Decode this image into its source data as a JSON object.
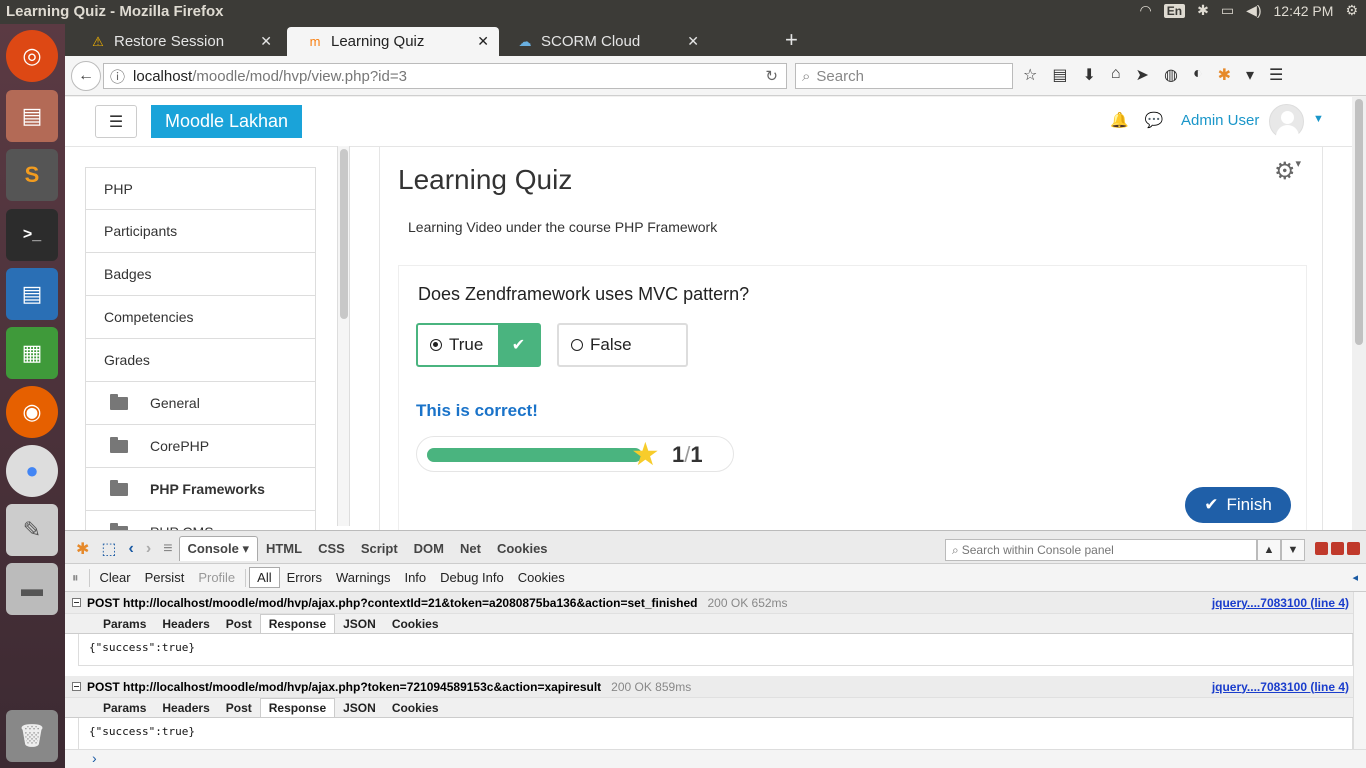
{
  "window": {
    "title": "Learning Quiz - Mozilla Firefox"
  },
  "system_tray": {
    "lang": "En",
    "time": "12:42 PM"
  },
  "tabs": [
    {
      "label": "Restore Session",
      "icon": "warning-icon",
      "active": false
    },
    {
      "label": "Learning Quiz",
      "icon": "moodle-icon",
      "active": true
    },
    {
      "label": "SCORM Cloud",
      "icon": "cloud-icon",
      "active": false
    }
  ],
  "navbar": {
    "url_host": "localhost",
    "url_path": "/moodle/mod/hvp/view.php?id=3",
    "search_placeholder": "Search"
  },
  "site": {
    "brand": "Moodle Lakhan",
    "menu_icon": "☰",
    "user": "Admin User"
  },
  "drawer": {
    "items": [
      {
        "label": "PHP",
        "sub": false,
        "bold": false
      },
      {
        "label": "Participants",
        "sub": false,
        "bold": false
      },
      {
        "label": "Badges",
        "sub": false,
        "bold": false
      },
      {
        "label": "Competencies",
        "sub": false,
        "bold": false
      },
      {
        "label": "Grades",
        "sub": false,
        "bold": false
      },
      {
        "label": "General",
        "sub": true,
        "bold": false
      },
      {
        "label": "CorePHP",
        "sub": true,
        "bold": false
      },
      {
        "label": "PHP Frameworks",
        "sub": true,
        "bold": true
      },
      {
        "label": "PHP CMS",
        "sub": true,
        "bold": false
      }
    ]
  },
  "main": {
    "title": "Learning Quiz",
    "description": "Learning Video under the course PHP Framework",
    "question": "Does Zendframework uses MVC pattern?",
    "answers": {
      "true_label": "True",
      "false_label": "False"
    },
    "feedback": "This is correct!",
    "score": {
      "earned": "1",
      "separator": "/",
      "max": "1",
      "fill_fraction": 1.0
    },
    "finish_label": "Finish"
  },
  "firebug": {
    "tabs": [
      "Console",
      "HTML",
      "CSS",
      "Script",
      "DOM",
      "Net",
      "Cookies"
    ],
    "active_tab": "Console",
    "search_placeholder": "Search within Console panel",
    "filters": {
      "clear": "Clear",
      "persist": "Persist",
      "profile": "Profile",
      "levels": [
        "All",
        "Errors",
        "Warnings",
        "Info",
        "Debug Info",
        "Cookies"
      ]
    },
    "requests": [
      {
        "method_url": "POST http://localhost/moodle/mod/hvp/ajax.php?contextId=21&token=a2080875ba136&action=set_finished",
        "status": "200 OK 652ms",
        "source": "jquery....7083100 (line 4)",
        "tabs": [
          "Params",
          "Headers",
          "Post",
          "Response",
          "JSON",
          "Cookies"
        ],
        "active_tab": "Response",
        "body": "{\"success\":true}"
      },
      {
        "method_url": "POST http://localhost/moodle/mod/hvp/ajax.php?token=721094589153c&action=xapiresult",
        "status": "200 OK 859ms",
        "source": "jquery....7083100 (line 4)",
        "tabs": [
          "Params",
          "Headers",
          "Post",
          "Response",
          "JSON",
          "Cookies"
        ],
        "active_tab": "Response",
        "body": "{\"success\":true}"
      }
    ],
    "cmd_prompt": "›"
  },
  "colors": {
    "accent": "#1aa3d9",
    "correct": "#4ab47f",
    "finish": "#1f5fa8",
    "feedback": "#1a73c9"
  }
}
